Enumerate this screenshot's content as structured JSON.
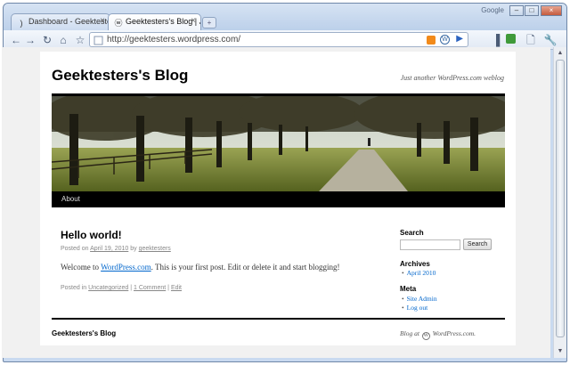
{
  "browser": {
    "brand_label": "Google",
    "tabs": [
      {
        "label": "Dashboard - Geektesters'...",
        "active": false
      },
      {
        "label": "Geektesters's Blog | Just a...",
        "active": true
      }
    ],
    "new_tab_icon": "new-tab-icon",
    "address": "http://geektesters.wordpress.com/",
    "window_buttons": [
      "minimize",
      "maximize",
      "close"
    ]
  },
  "site": {
    "title": "Geektesters's Blog",
    "description": "Just another WordPress.com weblog",
    "nav": [
      "About"
    ]
  },
  "post": {
    "title": "Hello world!",
    "meta_prefix": "Posted on",
    "date": "April 19, 2010",
    "meta_by": "by",
    "author": "geektesters",
    "body_prefix": "Welcome to",
    "body_link": "WordPress.com",
    "body_suffix": ". This is your first post. Edit or delete it and start blogging!",
    "posted_in_prefix": "Posted in",
    "category": "Uncategorized",
    "sep": "|",
    "comments": "1 Comment",
    "edit": "Edit"
  },
  "sidebar": {
    "search_heading": "Search",
    "search_button": "Search",
    "archives_heading": "Archives",
    "archives": [
      "April 2010"
    ],
    "meta_heading": "Meta",
    "meta_items": [
      "Site Admin",
      "Log out"
    ]
  },
  "footer": {
    "left": "Geektesters's Blog",
    "right_prefix": "Blog at",
    "right_link": "WordPress.com",
    "right_suffix": "."
  },
  "colors": {
    "chrome_frame": "#c9daf0",
    "link": "#0066cc",
    "nav_bg": "#000000"
  }
}
